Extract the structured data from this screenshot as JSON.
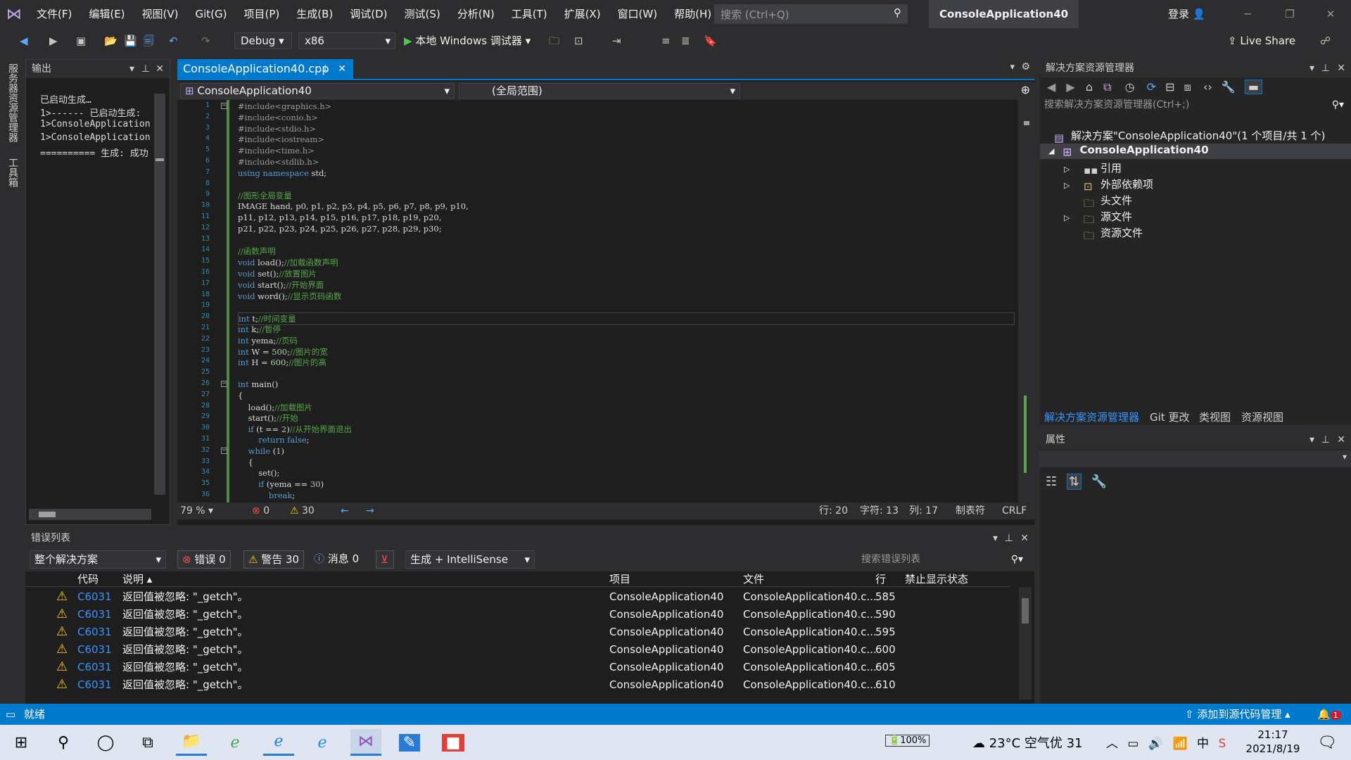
{
  "menu": [
    "文件(F)",
    "编辑(E)",
    "视图(V)",
    "Git(G)",
    "项目(P)",
    "生成(B)",
    "调试(D)",
    "测试(S)",
    "分析(N)",
    "工具(T)",
    "扩展(X)",
    "窗口(W)",
    "帮助(H)"
  ],
  "search": {
    "placeholder": "搜索 (Ctrl+Q)"
  },
  "solution_title": "ConsoleApplication40",
  "login": "登录",
  "toolbar": {
    "config": "Debug",
    "platform": "x86",
    "debugger": "本地 Windows 调试器",
    "live_share": "Live Share"
  },
  "left_strip": {
    "tab1": "服务器资源管理器",
    "tab2": "工具箱"
  },
  "output": {
    "title": "输出",
    "lines": [
      "已启动生成…",
      "1>------ 已启动生成:",
      "1>ConsoleApplication",
      "1>ConsoleApplication",
      "========== 生成: 成功"
    ]
  },
  "editor": {
    "tab_label": "ConsoleApplication40.cpp",
    "nav_project": "ConsoleApplication40",
    "nav_scope": "(全局范围)",
    "zoom": "79 %",
    "errors": "0",
    "warnings": "30",
    "row": "行: 20",
    "char": "字符: 13",
    "col": "列: 17",
    "tabs": "制表符",
    "eol": "CRLF"
  },
  "code": [
    "#include<graphics.h>",
    "#include<conio.h>",
    "#include<stdio.h>",
    "#include<iostream>",
    "#include<time.h>",
    "#include<stdlib.h>",
    "using namespace std;",
    "",
    "//图形全局变量",
    "IMAGE hand, p0, p1, p2, p3, p4, p5, p6, p7, p8, p9, p10,",
    "p11, p12, p13, p14, p15, p16, p17, p18, p19, p20,",
    "p21, p22, p23, p24, p25, p26, p27, p28, p29, p30;",
    "",
    "//函数声明",
    "void load();//加载函数声明",
    "void set();//放置图片",
    "void start();//开始界面",
    "void word();//显示页码函数",
    "",
    "int t;//时间变量",
    "int k;//暂停",
    "int yema;//页码",
    "int W = 500;//图片的宽",
    "int H = 600;//图片的高",
    "",
    "int main()",
    "{",
    "    load();//加载图片",
    "    start();//开始",
    "    if (t == 2)//从开始界面退出",
    "        return false;",
    "    while (1)",
    "    {",
    "        set();",
    "        if (yema == 30)",
    "            break;",
    "    }"
  ],
  "solution_explorer": {
    "title": "解决方案资源管理器",
    "search_placeholder": "搜索解决方案资源管理器(Ctrl+;)",
    "solution": "解决方案\"ConsoleApplication40\"(1 个项目/共 1 个)",
    "project": "ConsoleApplication40",
    "items": [
      "引用",
      "外部依赖项",
      "头文件",
      "源文件",
      "资源文件"
    ],
    "tabs": [
      "解决方案资源管理器",
      "Git 更改",
      "类视图",
      "资源视图"
    ]
  },
  "properties": {
    "title": "属性"
  },
  "error_list": {
    "title": "错误列表",
    "scope": "整个解决方案",
    "errors_btn": "错误 0",
    "warnings_btn": "警告 30",
    "messages_btn": "消息 0",
    "build_filter": "生成 + IntelliSense",
    "search_placeholder": "搜索错误列表",
    "columns": {
      "code": "代码",
      "desc": "说明",
      "project": "项目",
      "file": "文件",
      "line": "行",
      "suppress": "禁止显示状态"
    },
    "rows": [
      {
        "code": "C6031",
        "desc": "返回值被忽略: \"_getch\"。",
        "project": "ConsoleApplication40",
        "file": "ConsoleApplication40.c...",
        "line": "585"
      },
      {
        "code": "C6031",
        "desc": "返回值被忽略: \"_getch\"。",
        "project": "ConsoleApplication40",
        "file": "ConsoleApplication40.c...",
        "line": "590"
      },
      {
        "code": "C6031",
        "desc": "返回值被忽略: \"_getch\"。",
        "project": "ConsoleApplication40",
        "file": "ConsoleApplication40.c...",
        "line": "595"
      },
      {
        "code": "C6031",
        "desc": "返回值被忽略: \"_getch\"。",
        "project": "ConsoleApplication40",
        "file": "ConsoleApplication40.c...",
        "line": "600"
      },
      {
        "code": "C6031",
        "desc": "返回值被忽略: \"_getch\"。",
        "project": "ConsoleApplication40",
        "file": "ConsoleApplication40.c...",
        "line": "605"
      },
      {
        "code": "C6031",
        "desc": "返回值被忽略: \"_getch\"。",
        "project": "ConsoleApplication40",
        "file": "ConsoleApplication40.c...",
        "line": "610"
      }
    ]
  },
  "status": {
    "ready": "就绪",
    "source_control": "添加到源代码管理",
    "notif_count": "1"
  },
  "taskbar": {
    "battery": "100%",
    "weather": "23°C 空气优 31",
    "ime": "中",
    "time": "21:17",
    "date": "2021/8/19"
  }
}
